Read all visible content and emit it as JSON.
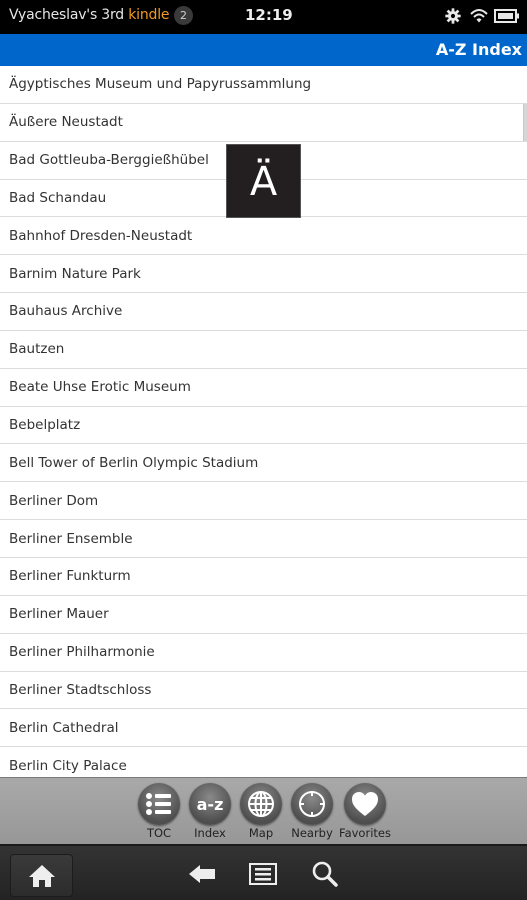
{
  "status_bar": {
    "device_name": "Vyacheslav's 3rd",
    "brand": "kindle",
    "notification_count": "2",
    "time": "12:19",
    "icons": [
      "gear-icon",
      "wifi-icon",
      "battery-icon"
    ]
  },
  "header": {
    "title": "A-Z Index"
  },
  "list": {
    "items": [
      "Ägyptisches Museum und Papyrussammlung",
      "Äußere Neustadt",
      "Bad Gottleuba-Berggießhübel",
      "Bad Schandau",
      "Bahnhof Dresden-Neustadt",
      "Barnim Nature Park",
      "Bauhaus Archive",
      "Bautzen",
      "Beate Uhse Erotic Museum",
      "Bebelplatz",
      "Bell Tower of Berlin Olympic Stadium",
      "Berliner Dom",
      "Berliner Ensemble",
      "Berliner Funkturm",
      "Berliner Mauer",
      "Berliner Philharmonie",
      "Berliner Stadtschloss",
      "Berlin Cathedral",
      "Berlin City Palace"
    ]
  },
  "letter_popup": "Ä",
  "toolbar": {
    "items": [
      {
        "label": "TOC",
        "icon": "list-icon"
      },
      {
        "label": "Index",
        "icon": "a-z-icon",
        "glyph": "a-z"
      },
      {
        "label": "Map",
        "icon": "globe-icon"
      },
      {
        "label": "Nearby",
        "icon": "crosshair-icon"
      },
      {
        "label": "Favorites",
        "icon": "heart-icon"
      }
    ]
  },
  "nav": {
    "buttons": [
      "home-icon",
      "back-icon",
      "menu-icon",
      "search-icon"
    ]
  }
}
